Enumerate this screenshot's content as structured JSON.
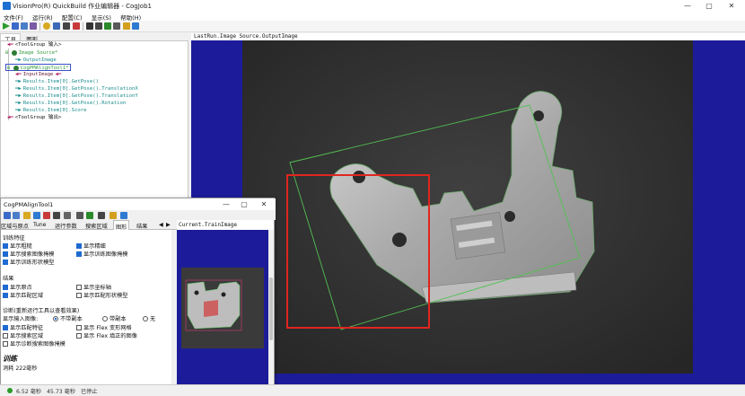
{
  "window": {
    "title": "VisionPro(R) QuickBuild 作业编辑器 - CogJob1",
    "minimize": "—",
    "maximize": "▢",
    "close": "✕"
  },
  "menu": [
    "文件(F)",
    "运行(R)",
    "配置(C)",
    "显示(S)",
    "帮助(H)"
  ],
  "left_panel": {
    "tabs": [
      "工具",
      "图形"
    ],
    "tree": [
      {
        "text": "<ToolGroup 输入>",
        "kind": "in"
      },
      {
        "text": "Image Source*",
        "kind": "tool-green"
      },
      {
        "text": "OutputImage",
        "kind": "out"
      },
      {
        "text": "CogPMAlignTool1*",
        "kind": "tool-selected"
      },
      {
        "text": "InputImage",
        "kind": "in"
      },
      {
        "text": "Results.Item[0].GetPose()",
        "kind": "out"
      },
      {
        "text": "Results.Item[0].GetPose().TranslationX",
        "kind": "out"
      },
      {
        "text": "Results.Item[0].GetPose().TranslationY",
        "kind": "out"
      },
      {
        "text": "Results.Item[0].GetPose().Rotation",
        "kind": "out"
      },
      {
        "text": "Results.Item[0].Score",
        "kind": "out"
      },
      {
        "text": "<ToolGroup 输出>",
        "kind": "in"
      }
    ]
  },
  "image_pane": {
    "header": "LastRun.Image Source.OutputImage"
  },
  "tool_window": {
    "title": "CogPMAlignTool1",
    "tabs": [
      "区域与原点",
      "Tune",
      "运行参数",
      "搜索区域",
      "图形",
      "结果"
    ],
    "image_header": "Current.TrainImage",
    "groups": {
      "train_features": "训练特征",
      "result": "结果",
      "diagnostics": "诊断(重新运行工具以查看效果)"
    },
    "checkboxes": [
      {
        "label": "显示粗糙",
        "checked": true
      },
      {
        "label": "显示精细",
        "checked": true
      },
      {
        "label": "显示搜索图像掩模",
        "checked": true
      },
      {
        "label": "显示训练图像掩模",
        "checked": true
      },
      {
        "label": "显示训练形状模型",
        "checked": true
      },
      {
        "label": "显示原点",
        "checked": true
      },
      {
        "label": "显示坐标轴",
        "checked": false
      },
      {
        "label": "显示匹配区域",
        "checked": true
      },
      {
        "label": "显示匹配形状模型",
        "checked": false
      },
      {
        "label": "显示匹配特征",
        "checked": true
      },
      {
        "label": "显示 Flex 变形网格",
        "checked": false
      },
      {
        "label": "显示搜索区域",
        "checked": false
      },
      {
        "label": "显示 Flex 填正的图像",
        "checked": false
      },
      {
        "label": "显示诊断搜索图像掩模",
        "checked": false
      }
    ],
    "input_image_label": "显示输入图像:",
    "radios": [
      {
        "label": "不带副本",
        "checked": true
      },
      {
        "label": "带副本",
        "checked": false
      },
      {
        "label": "无",
        "checked": false
      }
    ],
    "footer_big": "训练",
    "footer_small": "消耗 222毫秒"
  },
  "status": {
    "x": "6.52 毫秒",
    "y": "45.73 毫秒",
    "state": "已停止"
  }
}
